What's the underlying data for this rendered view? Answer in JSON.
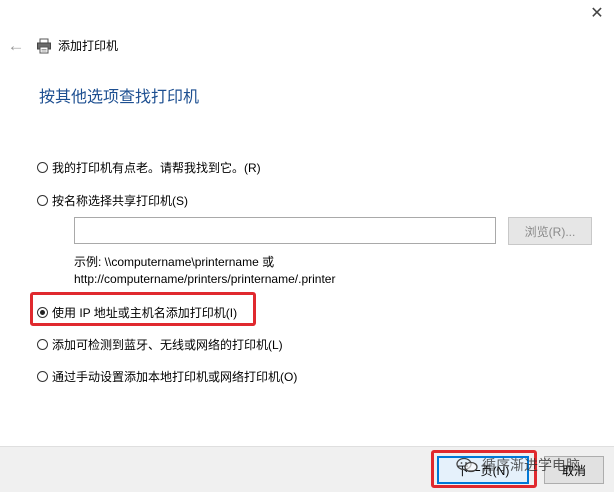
{
  "window": {
    "title": "添加打印机",
    "close_glyph": "✕",
    "back_glyph": "←"
  },
  "heading": "按其他选项查找打印机",
  "options": [
    {
      "label": "我的打印机有点老。请帮我找到它。(R)",
      "selected": false
    },
    {
      "label": "按名称选择共享打印机(S)",
      "selected": false
    },
    {
      "label": "使用 IP 地址或主机名添加打印机(I)",
      "selected": true
    },
    {
      "label": "添加可检测到蓝牙、无线或网络的打印机(L)",
      "selected": false
    },
    {
      "label": "通过手动设置添加本地打印机或网络打印机(O)",
      "selected": false
    }
  ],
  "share_input": {
    "value": "",
    "placeholder": ""
  },
  "browse_label": "浏览(R)...",
  "example": {
    "line1": "示例: \\\\computername\\printername 或",
    "line2": "http://computername/printers/printername/.printer"
  },
  "footer": {
    "next_label": "下一页(N)",
    "cancel_label": "取消"
  },
  "watermark_text": "循序渐进学电脑",
  "colors": {
    "heading": "#1d4f91",
    "highlight": "#e0292e",
    "primary_border": "#0078d7"
  },
  "icons": [
    "printer-icon",
    "back-arrow-icon",
    "close-icon",
    "wechat-icon"
  ]
}
